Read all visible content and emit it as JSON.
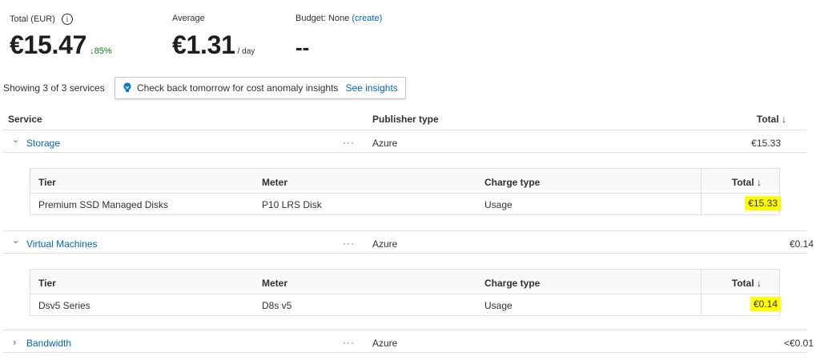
{
  "summary": {
    "total_label": "Total (EUR)",
    "total_value": "€15.47",
    "total_change": "↓85%",
    "average_label": "Average",
    "average_value": "€1.31",
    "average_unit": "/ day",
    "budget_label": "Budget: None",
    "budget_link": "(create)",
    "budget_value": "--"
  },
  "toolbar": {
    "showing_text": "Showing 3 of 3 services",
    "insight_text": "Check back tomorrow for cost anomaly insights",
    "insight_link": "See insights"
  },
  "table": {
    "headers": {
      "service": "Service",
      "publisher": "Publisher type",
      "total": "Total ↓"
    },
    "rows": [
      {
        "name": "Storage",
        "publisher": "Azure",
        "total": "€15.33",
        "expanded": true,
        "sub_headers": {
          "tier": "Tier",
          "meter": "Meter",
          "charge": "Charge type",
          "total": "Total ↓"
        },
        "sub_rows": [
          {
            "tier": "Premium SSD Managed Disks",
            "meter": "P10 LRS Disk",
            "charge": "Usage",
            "total": "€15.33"
          }
        ]
      },
      {
        "name": "Virtual Machines",
        "publisher": "Azure",
        "total": "€0.14",
        "expanded": true,
        "sub_headers": {
          "tier": "Tier",
          "meter": "Meter",
          "charge": "Charge type",
          "total": "Total ↓"
        },
        "sub_rows": [
          {
            "tier": "Dsv5 Series",
            "meter": "D8s v5",
            "charge": "Usage",
            "total": "€0.14"
          }
        ]
      },
      {
        "name": "Bandwidth",
        "publisher": "Azure",
        "total": "<€0.01",
        "expanded": false
      }
    ],
    "chevron_expanded": "⌄",
    "chevron_collapsed": "›",
    "more": "···"
  },
  "colors": {
    "link": "#0067b8",
    "positive": "#107c10",
    "highlight": "#ffff00"
  },
  "icons": {
    "info": "info-icon",
    "insight": "lightbulb-icon",
    "sort": "arrow-down-icon"
  }
}
